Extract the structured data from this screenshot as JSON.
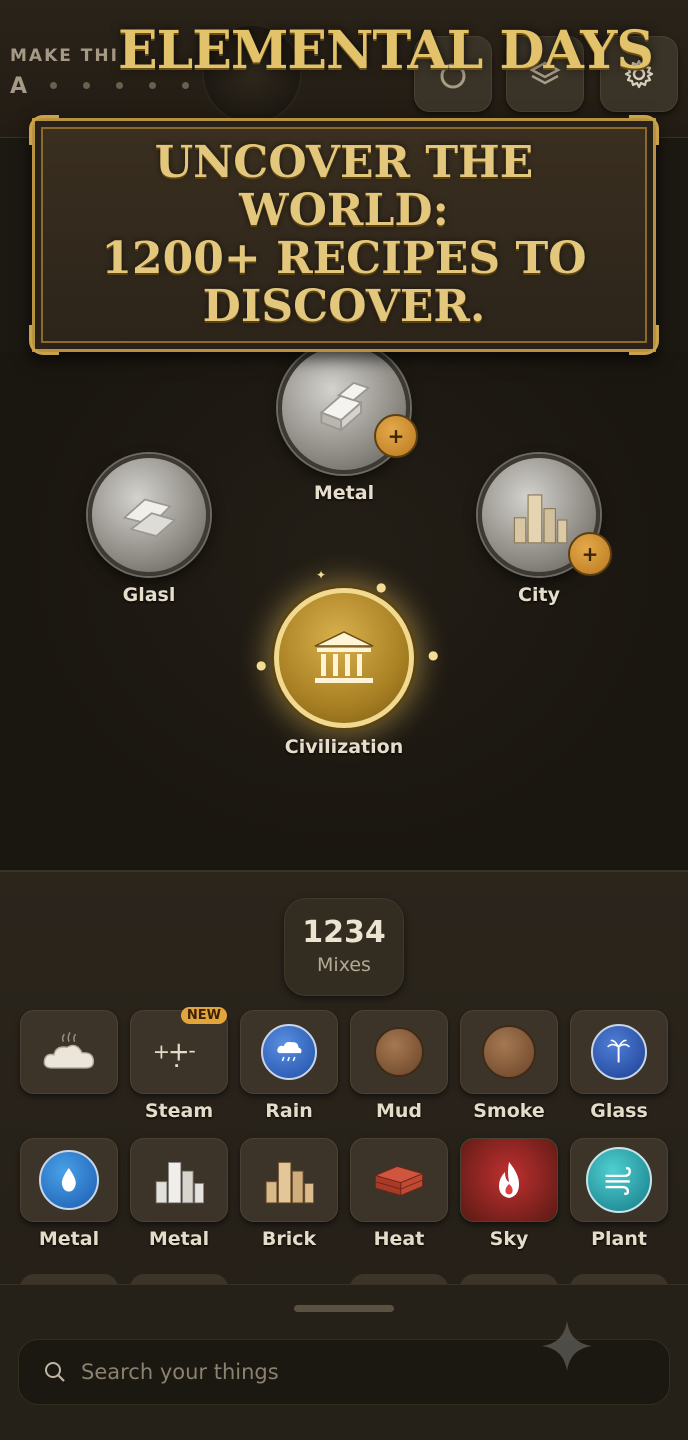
{
  "header": {
    "goal_label": "MAKE THI",
    "goal_letter": "A",
    "title": "ELEMENTAL DAYS"
  },
  "banner": {
    "line1": "UNCOVER THE WORLD:",
    "line2": "1200+ RECIPES TO",
    "line3": "DISCOVER."
  },
  "board": {
    "nodes": [
      {
        "label": "Metal",
        "icon": "metal-ingot-icon",
        "badge": "+"
      },
      {
        "label": "Glasl",
        "icon": "glass-shard-icon"
      },
      {
        "label": "City",
        "icon": "city-buildings-icon",
        "badge": "+"
      },
      {
        "label": "Civilization",
        "icon": "temple-icon"
      }
    ]
  },
  "mixes": {
    "count": "1234",
    "label": "Mixes"
  },
  "inventory": {
    "new_badge": "NEW",
    "row1": [
      {
        "label": "",
        "icon": "cloud-steam-icon"
      },
      {
        "label": "Steam",
        "icon": "plus-minus-icon"
      },
      {
        "label": "Rain",
        "icon": "rain-cloud-icon"
      },
      {
        "label": "Mud",
        "icon": "mud-icon"
      },
      {
        "label": "Smoke",
        "icon": "smoke-icon"
      },
      {
        "label": "Glass",
        "icon": "palm-tree-icon"
      }
    ],
    "row2": [
      {
        "label": "Metal",
        "icon": "water-drop-icon"
      },
      {
        "label": "Metal",
        "icon": "city-buildings-icon"
      },
      {
        "label": "Brick",
        "icon": "city-buildings-icon"
      },
      {
        "label": "Heat",
        "icon": "bricks-icon"
      },
      {
        "label": "Sky",
        "icon": "fire-icon"
      },
      {
        "label": "Plant",
        "icon": "wind-icon"
      }
    ]
  },
  "search": {
    "placeholder": "Search your things"
  },
  "colors": {
    "accent_gold": "#e2c26a",
    "background": "#1c1812",
    "badge_orange": "#e3a43b"
  }
}
